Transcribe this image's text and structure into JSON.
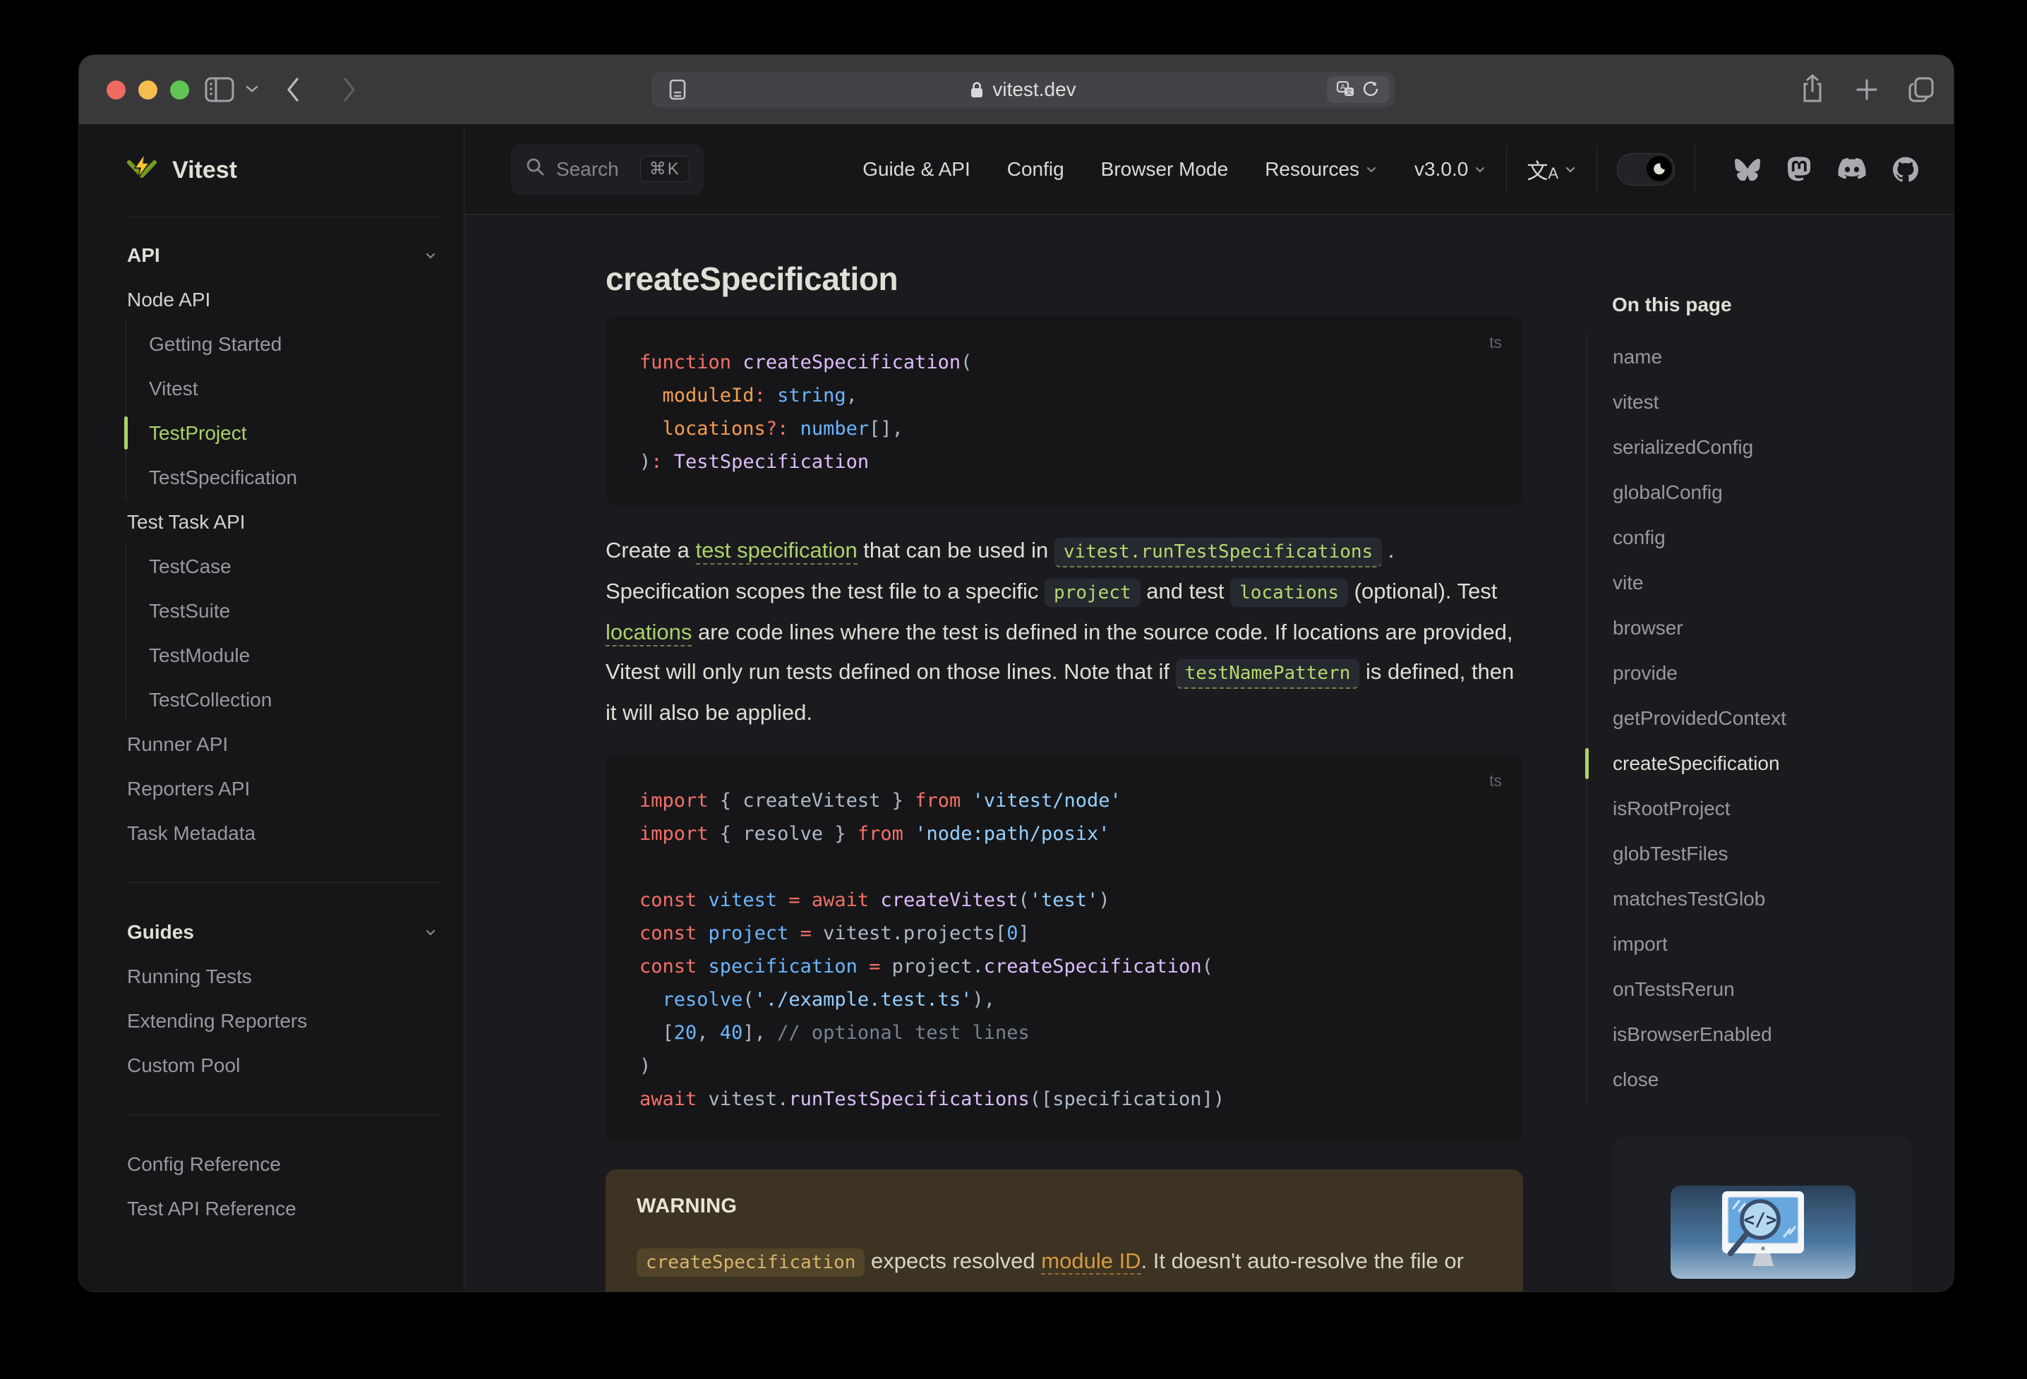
{
  "browser": {
    "url": "vitest.dev",
    "traffic_lights": [
      "close",
      "minimize",
      "fullscreen"
    ],
    "toolbar_icons": [
      "sidebar-toggle-icon",
      "chevron-down-icon",
      "back-icon",
      "forward-icon",
      "reader-icon",
      "lock-icon",
      "translate-icon",
      "reload-icon",
      "share-icon",
      "new-tab-icon",
      "tabs-icon"
    ]
  },
  "nav": {
    "search": {
      "label": "Search",
      "shortcut": "⌘K"
    },
    "links": [
      {
        "label": "Guide & API",
        "chevron": false
      },
      {
        "label": "Config",
        "chevron": false
      },
      {
        "label": "Browser Mode",
        "chevron": false
      },
      {
        "label": "Resources",
        "chevron": true
      },
      {
        "label": "v3.0.0",
        "chevron": true
      }
    ],
    "social_icons": [
      "bluesky-icon",
      "mastodon-icon",
      "discord-icon",
      "github-icon"
    ],
    "theme_toggle": "dark",
    "language_icon": "translate-icon"
  },
  "sidebar": {
    "logo_text": "Vitest",
    "logo_icon": "vitest-logo-icon",
    "items": [
      {
        "kind": "section",
        "label": "API",
        "chevron": true
      },
      {
        "kind": "top",
        "label": "Node API",
        "emph": true
      },
      {
        "kind": "nested",
        "label": "Getting Started"
      },
      {
        "kind": "nested",
        "label": "Vitest"
      },
      {
        "kind": "nested",
        "label": "TestProject",
        "active": true
      },
      {
        "kind": "nested",
        "label": "TestSpecification"
      },
      {
        "kind": "top",
        "label": "Test Task API",
        "emph": true
      },
      {
        "kind": "nested",
        "label": "TestCase"
      },
      {
        "kind": "nested",
        "label": "TestSuite"
      },
      {
        "kind": "nested",
        "label": "TestModule"
      },
      {
        "kind": "nested",
        "label": "TestCollection"
      },
      {
        "kind": "top",
        "label": "Runner API"
      },
      {
        "kind": "top",
        "label": "Reporters API"
      },
      {
        "kind": "top",
        "label": "Task Metadata"
      },
      {
        "kind": "divider"
      },
      {
        "kind": "section",
        "label": "Guides",
        "chevron": true
      },
      {
        "kind": "top",
        "label": "Running Tests"
      },
      {
        "kind": "top",
        "label": "Extending Reporters"
      },
      {
        "kind": "top",
        "label": "Custom Pool"
      },
      {
        "kind": "divider"
      },
      {
        "kind": "top",
        "label": "Config Reference"
      },
      {
        "kind": "top",
        "label": "Test API Reference"
      }
    ]
  },
  "outline": {
    "title": "On this page",
    "items": [
      "name",
      "vitest",
      "serializedConfig",
      "globalConfig",
      "config",
      "vite",
      "browser",
      "provide",
      "getProvidedContext",
      "createSpecification",
      "isRootProject",
      "globTestFiles",
      "matchesTestGlob",
      "import",
      "onTestsRerun",
      "isBrowserEnabled",
      "close"
    ],
    "active_index": 9
  },
  "main": {
    "title": "createSpecification",
    "code_blocks": [
      {
        "lang": "ts",
        "lines": [
          [
            [
              "kw",
              "function "
            ],
            [
              "fn",
              "createSpecification"
            ],
            [
              "pu",
              "("
            ]
          ],
          [
            [
              "pl",
              "  "
            ],
            [
              "pr",
              "moduleId"
            ],
            [
              "kw",
              ":"
            ],
            [
              "pl",
              " "
            ],
            [
              "ty",
              "string"
            ],
            [
              "pu",
              ","
            ]
          ],
          [
            [
              "pl",
              "  "
            ],
            [
              "pr",
              "locations"
            ],
            [
              "kw",
              "?:"
            ],
            [
              "pl",
              " "
            ],
            [
              "ty",
              "number"
            ],
            [
              "pu",
              "[],"
            ]
          ],
          [
            [
              "pu",
              ")"
            ],
            [
              "kw",
              ":"
            ],
            [
              "pl",
              " "
            ],
            [
              "fn",
              "TestSpecification"
            ]
          ]
        ]
      },
      {
        "lang": "ts",
        "lines": [
          [
            [
              "kw",
              "import"
            ],
            [
              "pu",
              " { "
            ],
            [
              "pl",
              "createVitest"
            ],
            [
              "pu",
              " } "
            ],
            [
              "kw",
              "from"
            ],
            [
              "pl",
              " "
            ],
            [
              "st",
              "'vitest/node'"
            ]
          ],
          [
            [
              "kw",
              "import"
            ],
            [
              "pu",
              " { "
            ],
            [
              "pl",
              "resolve"
            ],
            [
              "pu",
              " } "
            ],
            [
              "kw",
              "from"
            ],
            [
              "pl",
              " "
            ],
            [
              "st",
              "'node:path/posix'"
            ]
          ],
          [],
          [
            [
              "kw",
              "const"
            ],
            [
              "pl",
              " "
            ],
            [
              "vr",
              "vitest"
            ],
            [
              "pl",
              " "
            ],
            [
              "kw",
              "="
            ],
            [
              "pl",
              " "
            ],
            [
              "kw",
              "await"
            ],
            [
              "pl",
              " "
            ],
            [
              "fn",
              "createVitest"
            ],
            [
              "pu",
              "("
            ],
            [
              "st",
              "'test'"
            ],
            [
              "pu",
              ")"
            ]
          ],
          [
            [
              "kw",
              "const"
            ],
            [
              "pl",
              " "
            ],
            [
              "vr",
              "project"
            ],
            [
              "pl",
              " "
            ],
            [
              "kw",
              "="
            ],
            [
              "pl",
              " "
            ],
            [
              "pl",
              "vitest.projects"
            ],
            [
              "pu",
              "["
            ],
            [
              "nu",
              "0"
            ],
            [
              "pu",
              "]"
            ]
          ],
          [
            [
              "kw",
              "const"
            ],
            [
              "pl",
              " "
            ],
            [
              "vr",
              "specification"
            ],
            [
              "pl",
              " "
            ],
            [
              "kw",
              "="
            ],
            [
              "pl",
              " "
            ],
            [
              "pl",
              "project."
            ],
            [
              "fn",
              "createSpecification"
            ],
            [
              "pu",
              "("
            ]
          ],
          [
            [
              "pl",
              "  "
            ],
            [
              "vr",
              "resolve"
            ],
            [
              "pu",
              "("
            ],
            [
              "st",
              "'./example.test.ts'"
            ],
            [
              "pu",
              "),"
            ]
          ],
          [
            [
              "pl",
              "  "
            ],
            [
              "pu",
              "["
            ],
            [
              "nu",
              "20"
            ],
            [
              "pu",
              ", "
            ],
            [
              "nu",
              "40"
            ],
            [
              "pu",
              "], "
            ],
            [
              "cm",
              "// optional test lines"
            ]
          ],
          [
            [
              "pu",
              ")"
            ]
          ],
          [
            [
              "kw",
              "await"
            ],
            [
              "pl",
              " "
            ],
            [
              "pl",
              "vitest."
            ],
            [
              "fn",
              "runTestSpecifications"
            ],
            [
              "pu",
              "(["
            ],
            [
              "pl",
              "specification"
            ],
            [
              "pu",
              "])"
            ]
          ]
        ]
      }
    ],
    "paragraph": [
      {
        "t": "text",
        "v": "Create a "
      },
      {
        "t": "link",
        "v": "test specification"
      },
      {
        "t": "text",
        "v": " that can be used in "
      },
      {
        "t": "codelink",
        "v": "vitest.runTestSpecifications"
      },
      {
        "t": "text",
        "v": " . Specification scopes the test file to a specific "
      },
      {
        "t": "code",
        "v": "project"
      },
      {
        "t": "text",
        "v": " and test "
      },
      {
        "t": "code",
        "v": "locations"
      },
      {
        "t": "text",
        "v": " (optional). Test "
      },
      {
        "t": "link",
        "v": "locations"
      },
      {
        "t": "text",
        "v": " are code lines where the test is defined in the source code. If locations are provided, Vitest will only run tests defined on those lines. Note that if "
      },
      {
        "t": "codelink",
        "v": "testNamePattern"
      },
      {
        "t": "text",
        "v": " is defined, then it will also be applied."
      }
    ],
    "warning": {
      "title": "WARNING",
      "body": [
        {
          "t": "code",
          "v": "createSpecification"
        },
        {
          "t": "text",
          "v": " expects resolved "
        },
        {
          "t": "linkwarn",
          "v": "module ID"
        },
        {
          "t": "text",
          "v": ". It doesn't auto-resolve the file or check that it exists on the file system."
        }
      ]
    }
  },
  "ad": {
    "icon": "code-search-monitor-icon"
  },
  "colors": {
    "brand_green": "#acd268",
    "content_bg": "#1b1b1f",
    "alt_bg": "#161618",
    "warning_bg": "#3c3322",
    "warning_link": "#d79a3e",
    "code_keyword": "#f47067",
    "code_function": "#dcbdfb",
    "code_string": "#96d0ff",
    "code_constant": "#6cb6ff",
    "code_parameter": "#f69d50",
    "code_comment": "#768390"
  }
}
